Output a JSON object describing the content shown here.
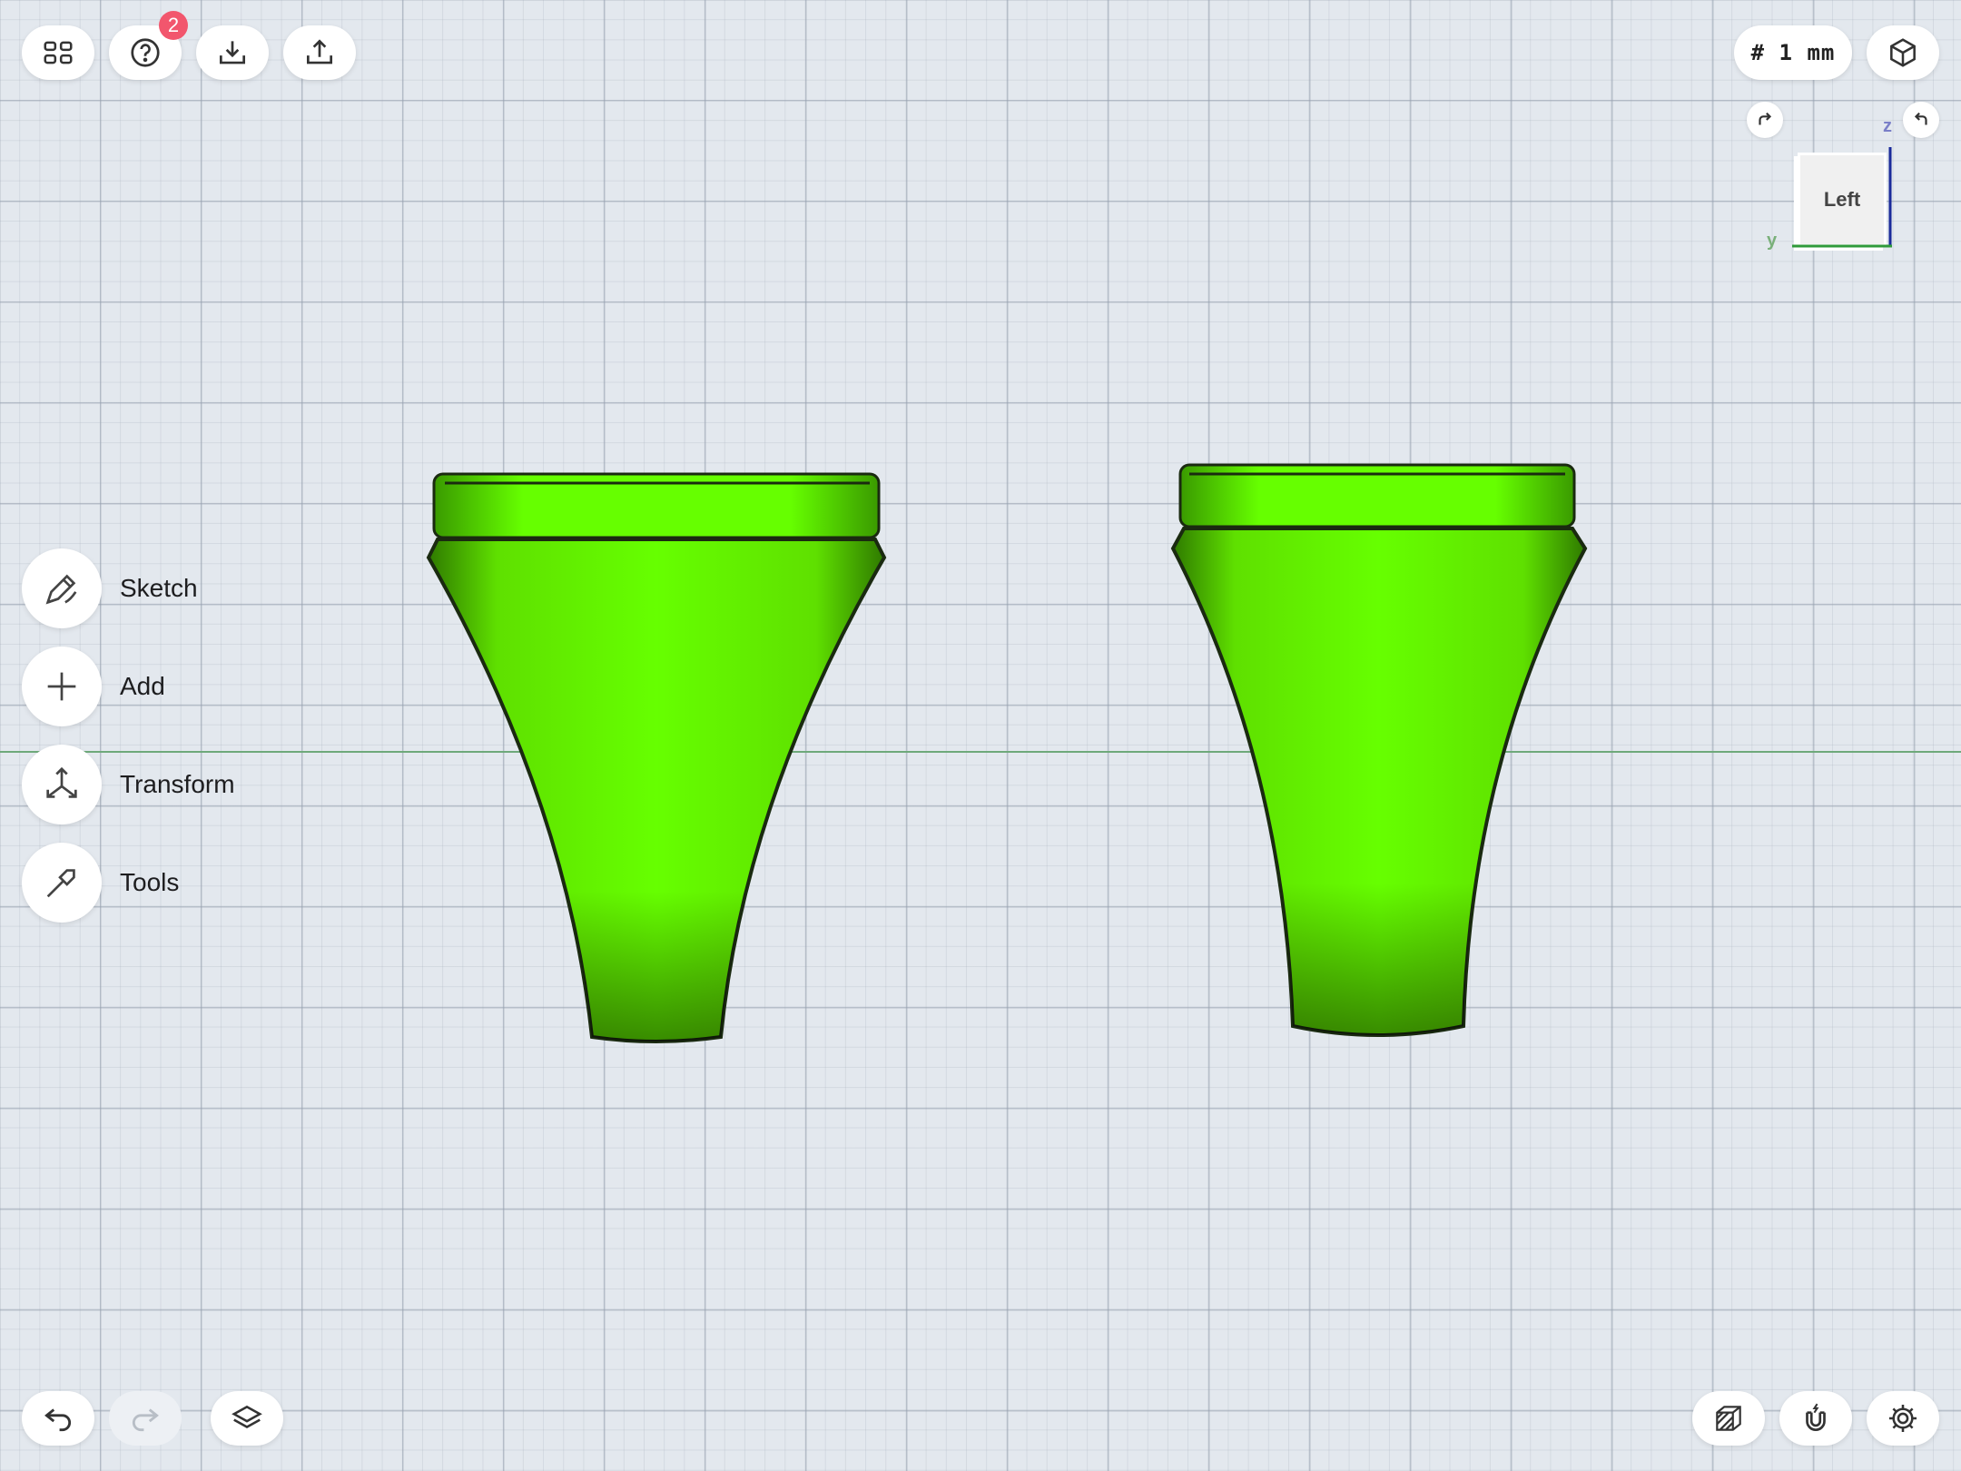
{
  "toolbar": {
    "help_badge": "2",
    "units_label": "# 1 mm"
  },
  "menu": {
    "items": [
      {
        "label": "Sketch",
        "icon": "sketch-pencil-icon"
      },
      {
        "label": "Add",
        "icon": "plus-icon"
      },
      {
        "label": "Transform",
        "icon": "transform-arrows-icon"
      },
      {
        "label": "Tools",
        "icon": "hammer-icon"
      }
    ]
  },
  "view_cube": {
    "face_label": "Left",
    "axis_z": "z",
    "axis_y": "y"
  },
  "colors": {
    "model_green": "#66ff00",
    "axis_z": "#1a2a9a",
    "axis_y": "#2f9a3a",
    "badge": "#f2566d"
  }
}
